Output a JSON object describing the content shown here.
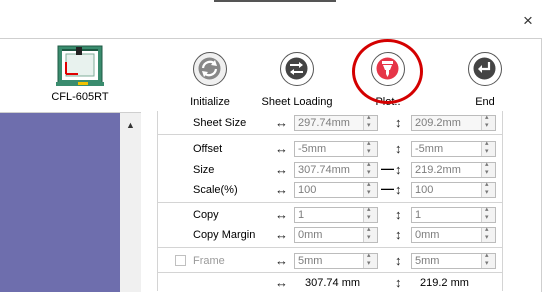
{
  "window": {
    "close_glyph": "×"
  },
  "device": {
    "name": "CFL-605RT"
  },
  "toolbar": [
    {
      "id": "initialize",
      "label": "Initialize",
      "icon": "refresh-icon"
    },
    {
      "id": "sheet-loading",
      "label": "Sheet Loading",
      "icon": "swap-arrows-icon"
    },
    {
      "id": "plot",
      "label": "Plot..",
      "icon": "cutter-pen-icon"
    },
    {
      "id": "end",
      "label": "End",
      "icon": "return-arrow-icon"
    }
  ],
  "form": {
    "sheet_size": {
      "label": "Sheet Size",
      "x": "297.74mm",
      "y": "209.2mm"
    },
    "offset": {
      "label": "Offset",
      "x": "-5mm",
      "y": "-5mm"
    },
    "size": {
      "label": "Size",
      "x": "307.74mm",
      "y": "219.2mm"
    },
    "scale": {
      "label": "Scale(%)",
      "x": "100",
      "y": "100"
    },
    "copy": {
      "label": "Copy",
      "x": "1",
      "y": "1"
    },
    "copy_margin": {
      "label": "Copy Margin",
      "x": "0mm",
      "y": "0mm"
    },
    "frame": {
      "label": "Frame",
      "checked": false,
      "x": "5mm",
      "y": "5mm"
    },
    "totals": {
      "x": "307.74 mm",
      "y": "219.2 mm"
    }
  },
  "symbols": {
    "horizontal": "↔",
    "vertical": "↕",
    "link": "—"
  },
  "colors": {
    "plot_highlight": "#d40000",
    "plot_icon": "#e63548",
    "list_bg": "#6e6ead"
  }
}
